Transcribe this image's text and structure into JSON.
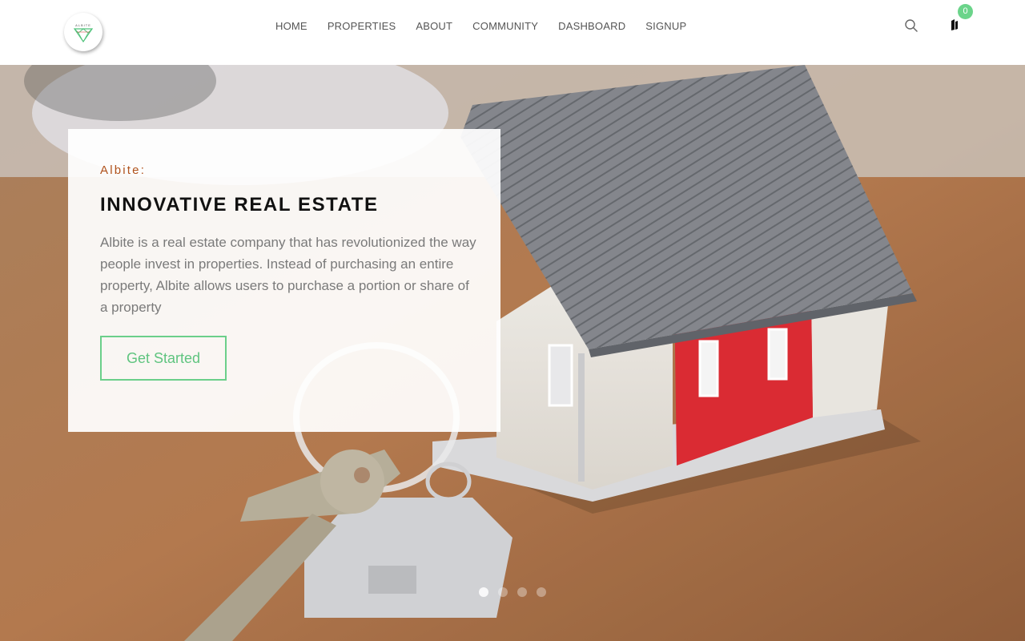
{
  "header": {
    "logo_icon": "albite-diamond-logo",
    "logo_text": "ALBITE",
    "nav": [
      {
        "label": "HOME"
      },
      {
        "label": "PROPERTIES"
      },
      {
        "label": "ABOUT"
      },
      {
        "label": "COMMUNITY"
      },
      {
        "label": "DASHBOARD"
      },
      {
        "label": "SIGNUP"
      }
    ],
    "search_icon": "search-icon",
    "cart_icon": "bag-icon",
    "cart_count": "0"
  },
  "hero": {
    "eyebrow": "Albite:",
    "title": "INNOVATIVE REAL ESTATE",
    "description": "Albite is a real estate company that has revolutionized the way people invest in properties. Instead of purchasing an entire property, Albite allows users to purchase a portion or share of a property",
    "cta_label": "Get Started",
    "slide_count": 4,
    "active_slide": 1
  },
  "colors": {
    "accent": "#6bcf8a",
    "eyebrow": "#b0521c",
    "nav_text": "#555555",
    "badge": "#6bd48a"
  }
}
